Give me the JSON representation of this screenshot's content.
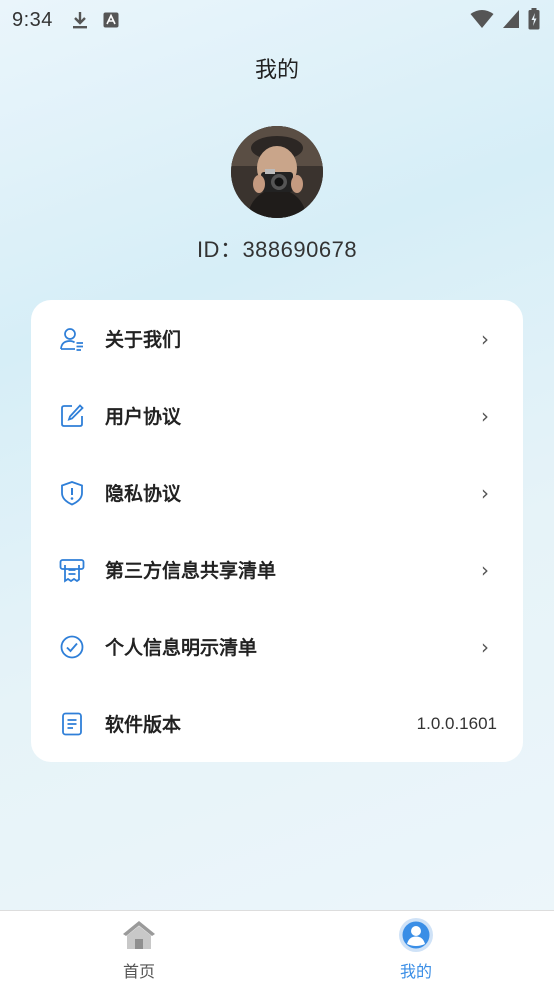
{
  "status": {
    "time": "9:34"
  },
  "header": {
    "title": "我的"
  },
  "profile": {
    "id_text": "ID：388690678"
  },
  "menu": {
    "items": [
      {
        "label": "关于我们",
        "icon": "user-profile-icon"
      },
      {
        "label": "用户协议",
        "icon": "edit-document-icon"
      },
      {
        "label": "隐私协议",
        "icon": "shield-alert-icon"
      },
      {
        "label": "第三方信息共享清单",
        "icon": "receipt-list-icon"
      },
      {
        "label": "个人信息明示清单",
        "icon": "check-circle-icon"
      },
      {
        "label": "软件版本",
        "icon": "document-lines-icon",
        "value": "1.0.0.1601"
      }
    ]
  },
  "tabbar": {
    "tabs": [
      {
        "label": "首页",
        "icon": "home-icon",
        "active": false
      },
      {
        "label": "我的",
        "icon": "person-icon",
        "active": true
      }
    ],
    "active_color": "#3a8ee6",
    "inactive_color": "#555555"
  },
  "colors": {
    "accent": "#2f7fd8",
    "card": "#ffffff"
  }
}
